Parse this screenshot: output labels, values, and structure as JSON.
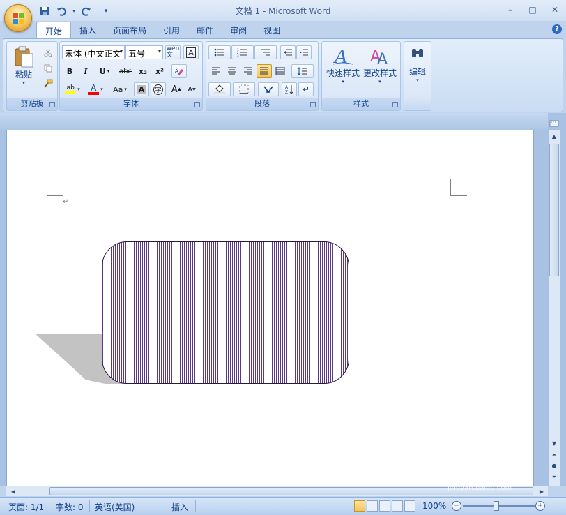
{
  "window": {
    "title": "文档 1 - Microsoft Word"
  },
  "qat": {
    "save_icon": "save-icon",
    "undo_icon": "undo-icon",
    "redo_icon": "redo-icon",
    "customize_icon": "customize-qat-icon"
  },
  "win_controls": {
    "minimize": "–",
    "maximize": "□",
    "close": "✕"
  },
  "tabs": [
    {
      "label": "开始",
      "active": true
    },
    {
      "label": "插入",
      "active": false
    },
    {
      "label": "页面布局",
      "active": false
    },
    {
      "label": "引用",
      "active": false
    },
    {
      "label": "邮件",
      "active": false
    },
    {
      "label": "审阅",
      "active": false
    },
    {
      "label": "视图",
      "active": false
    }
  ],
  "help": "?",
  "ribbon": {
    "clipboard": {
      "label": "剪贴板",
      "paste": "粘贴"
    },
    "font": {
      "label": "字体",
      "font_name": "宋体 (中文正文",
      "font_size": "五号",
      "bold": "B",
      "italic": "I",
      "underline": "U",
      "strike": "abc",
      "subscript": "x₂",
      "superscript": "x²",
      "grow": "A",
      "shrink": "A",
      "case": "Aa",
      "char_shade": "A",
      "enclose": "字",
      "highlight": "ab",
      "font_color": "A"
    },
    "paragraph": {
      "label": "段落"
    },
    "styles": {
      "label": "样式",
      "quick_styles": "快速样式",
      "change_styles": "更改样式"
    },
    "editing": {
      "label": "编辑"
    }
  },
  "status": {
    "page": "页面: 1/1",
    "words": "字数: 0",
    "language": "英语(美国)",
    "mode": "插入",
    "zoom": "100%",
    "zoom_level_percent": 100
  },
  "colors": {
    "shape_stripe": "#5a3a84",
    "shape_border": "#2b1a3d",
    "shadow": "#c3c3c3",
    "highlight_yellow": "#ffff00",
    "font_color_red": "#ff0000"
  },
  "watermark": {
    "brand": "Baidu经验",
    "site": "jingyan.baidu.com"
  }
}
